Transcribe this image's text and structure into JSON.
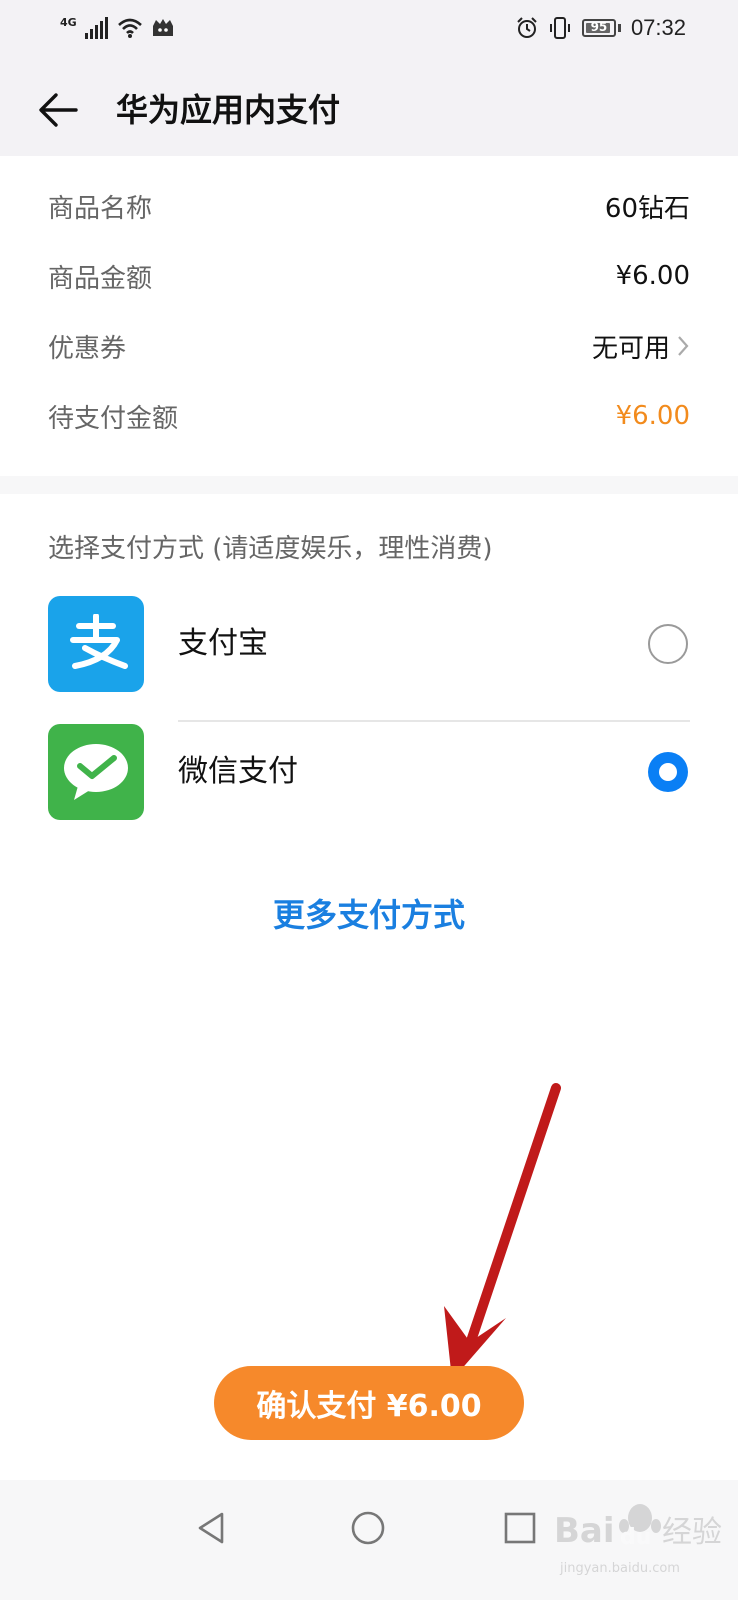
{
  "status_bar": {
    "network": "4G",
    "battery": "95",
    "battery_level": 0.95,
    "time": "07:32",
    "icons": [
      "signal-icon",
      "wifi-icon",
      "app-notification-icon",
      "alarm-icon",
      "vibrate-icon",
      "battery-icon"
    ]
  },
  "header": {
    "title": "华为应用内支付",
    "back_icon": "arrow-left-icon"
  },
  "order": {
    "rows": [
      {
        "label": "商品名称",
        "value": "60钻石"
      },
      {
        "label": "商品金额",
        "value": "¥6.00"
      },
      {
        "label": "优惠券",
        "value": "无可用"
      },
      {
        "label": "待支付金额",
        "value": "¥6.00"
      }
    ]
  },
  "payment": {
    "section_title": "选择支付方式 (请适度娱乐，理性消费)",
    "methods": [
      {
        "label": "支付宝",
        "icon": "alipay-icon",
        "selected": false
      },
      {
        "label": "微信支付",
        "icon": "wechat-pay-icon",
        "selected": true
      }
    ],
    "more_label": "更多支付方式"
  },
  "confirm": {
    "label": "确认支付 ¥6.00"
  },
  "navigation": {
    "icons": [
      "nav-back-icon",
      "nav-home-icon",
      "nav-recents-icon"
    ]
  },
  "watermark": {
    "text": "Baidu经验",
    "subtext": "jingyan.baidu.com"
  },
  "colors": {
    "accent_orange": "#f6892b",
    "price_orange": "#f28b1d",
    "link_blue": "#1a7fe0",
    "radio_blue": "#0a7ff5",
    "alipay_blue": "#1aa3ea",
    "wechat_green": "#40b34a",
    "annotation_red": "#c01a1a"
  }
}
